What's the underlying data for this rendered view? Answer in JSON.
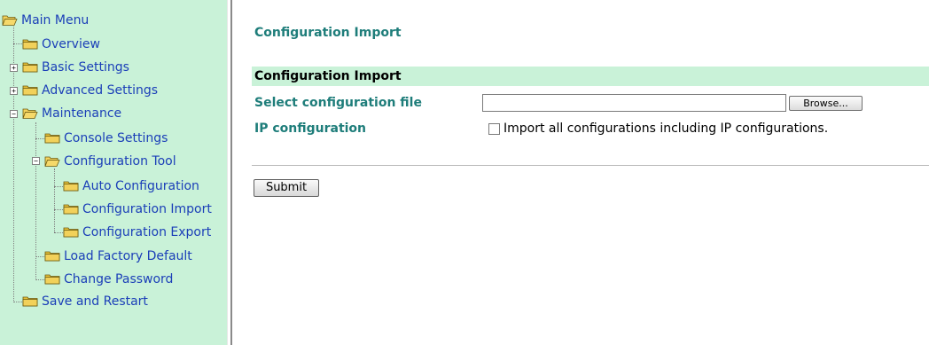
{
  "sidebar": {
    "main_menu": "Main Menu",
    "overview": "Overview",
    "basic_settings": "Basic Settings",
    "advanced_settings": "Advanced Settings",
    "maintenance": "Maintenance",
    "console_settings": "Console Settings",
    "configuration_tool": "Configuration Tool",
    "auto_configuration": "Auto Configuration",
    "configuration_import": "Configuration Import",
    "configuration_export": "Configuration Export",
    "load_factory_default": "Load Factory Default",
    "change_password": "Change Password",
    "save_and_restart": "Save and Restart"
  },
  "main": {
    "page_title": "Configuration Import",
    "section_header": "Configuration Import",
    "select_file_label": "Select configuration file",
    "file_value": "",
    "browse_label": "Browse...",
    "ip_config_label": "IP configuration",
    "ip_checkbox_label": "Import all configurations including IP configurations.",
    "submit_label": "Submit"
  },
  "colors": {
    "sidebar_bg": "#c9f2d8",
    "link": "#1b3fb8",
    "heading": "#1e7d7a",
    "folder": "#e8c33a"
  }
}
